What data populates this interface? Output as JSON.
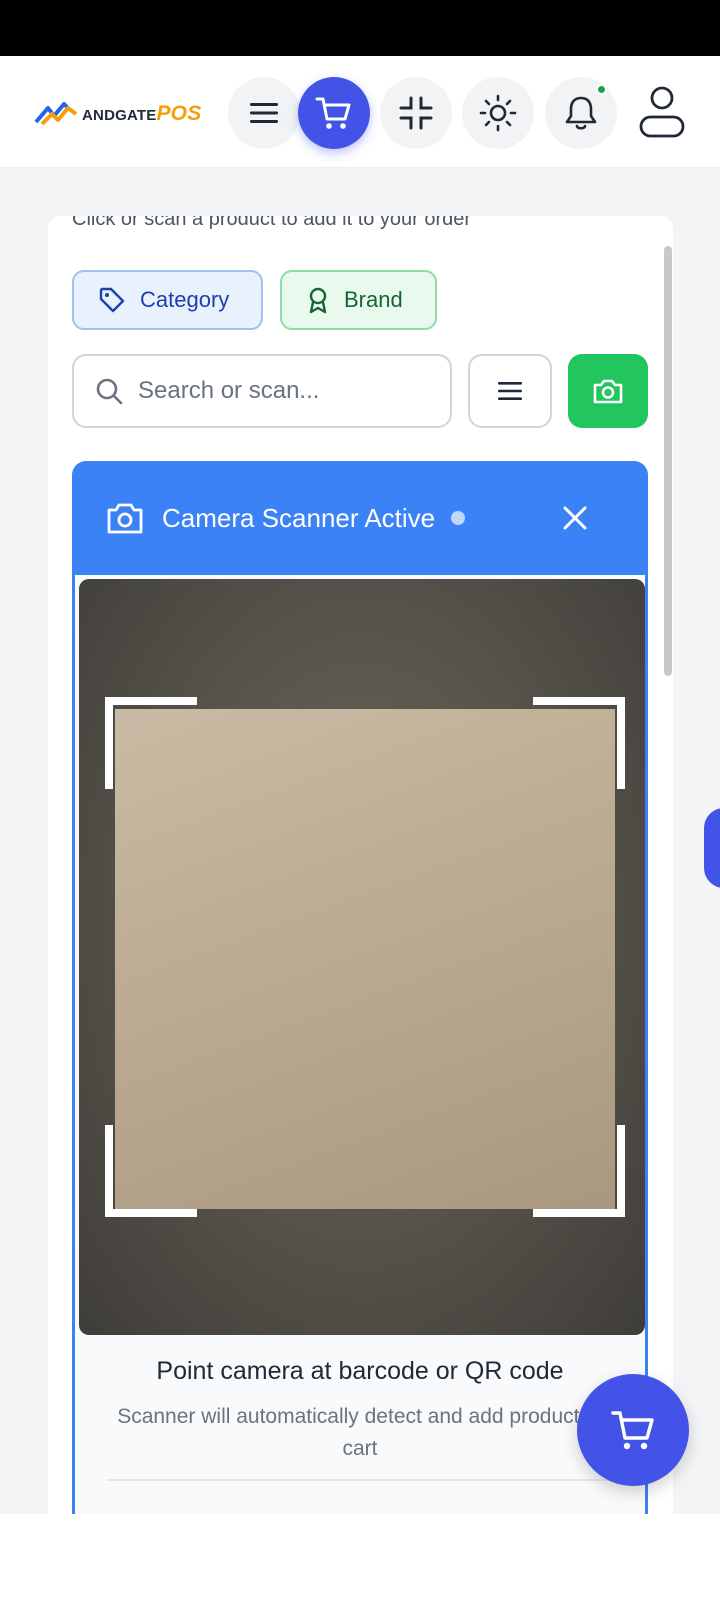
{
  "header": {
    "logo_text": "ANDGATE",
    "logo_accent": "POS",
    "buttons": [
      {
        "name": "menu-icon"
      },
      {
        "name": "cart-icon",
        "active": true
      },
      {
        "name": "minimize-icon"
      },
      {
        "name": "sun-icon"
      },
      {
        "name": "bell-icon",
        "has_notification": true
      },
      {
        "name": "user-icon"
      }
    ]
  },
  "main": {
    "subtitle": "Click or scan a product to add it to your order",
    "filters": {
      "category_label": "Category",
      "brand_label": "Brand"
    },
    "search": {
      "placeholder": "Search or scan..."
    }
  },
  "scanner": {
    "title": "Camera Scanner Active",
    "hint_title": "Point camera at barcode or QR code",
    "hint_text": "Scanner will automatically detect and add product to cart"
  },
  "colors": {
    "accent": "#4353e8",
    "scanner_header": "#3b82f6",
    "camera_button": "#22c55e",
    "notification_dot": "#16a34a"
  }
}
